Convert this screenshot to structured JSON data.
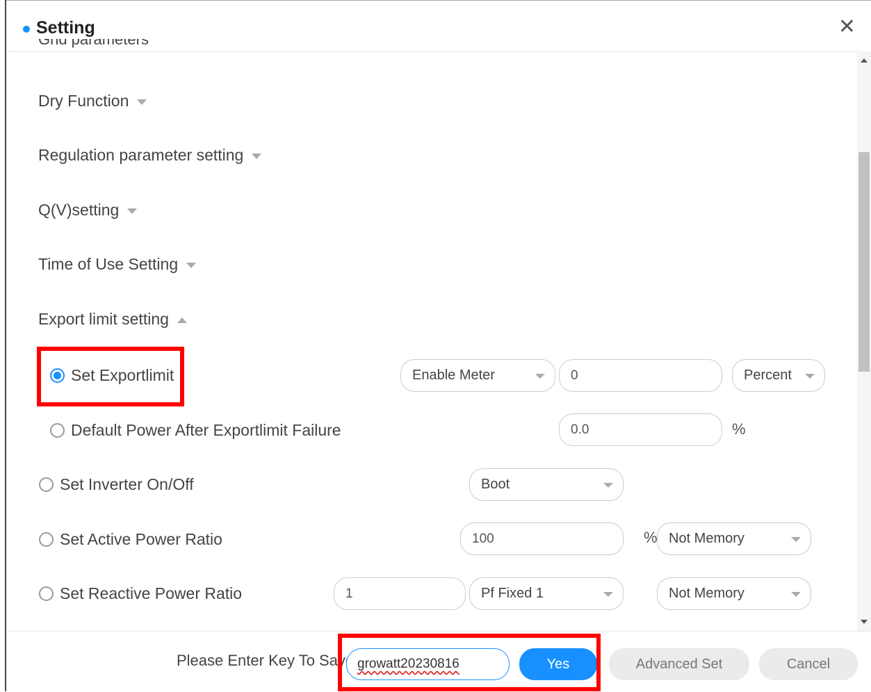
{
  "dialog": {
    "title": "Setting"
  },
  "partial_section": "Grid parameters",
  "sections": {
    "dry": "Dry Function",
    "regulation": "Regulation parameter setting",
    "qv": "Q(V)setting",
    "tou": "Time of Use Setting",
    "export": "Export limit setting"
  },
  "rows": {
    "exportlimit": {
      "label": "Set Exportlimit",
      "checked": true,
      "meter": "Enable Meter",
      "value": "0",
      "unit_select": "Percent"
    },
    "default_power": {
      "label": "Default Power After Exportlimit Failure",
      "checked": false,
      "value": "0.0",
      "unit": "%"
    },
    "inverter": {
      "label": "Set Inverter On/Off",
      "checked": false,
      "select": "Boot"
    },
    "active": {
      "label": "Set Active Power Ratio",
      "checked": false,
      "value": "100",
      "unit": "%",
      "memory": "Not Memory"
    },
    "reactive": {
      "label": "Set Reactive Power Ratio",
      "checked": false,
      "value": "1",
      "mode": "Pf Fixed 1",
      "memory": "Not Memory"
    }
  },
  "footer": {
    "key_label": "Please Enter Key To Save",
    "key_value": "growatt20230816",
    "yes": "Yes",
    "advanced": "Advanced Set",
    "cancel": "Cancel"
  },
  "colors": {
    "accent": "#1890ff",
    "highlight": "#ff0000"
  },
  "icons": {
    "close": "close-icon",
    "caret": "chevron-down-icon",
    "caret_up": "chevron-up-icon"
  }
}
